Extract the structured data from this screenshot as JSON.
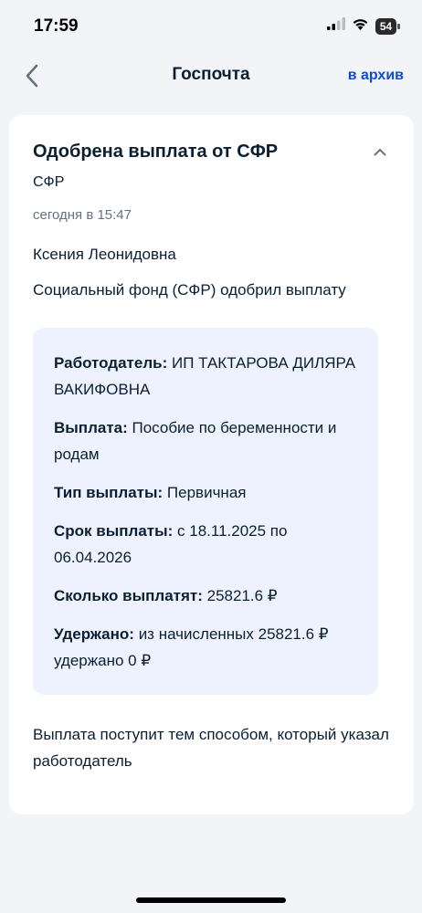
{
  "status_bar": {
    "time": "17:59",
    "battery": "54"
  },
  "nav": {
    "title": "Госпочта",
    "archive_label": "в архив"
  },
  "message": {
    "title": "Одобрена выплата от СФР",
    "sender": "СФР",
    "date": "сегодня в 15:47",
    "recipient": "Ксения Леонидовна",
    "lead": "Социальный фонд (СФР) одобрил выплату",
    "details": [
      {
        "label": "Работодатель:",
        "value": "ИП ТАКТАРОВА ДИЛЯРА ВАКИФОВНА"
      },
      {
        "label": "Выплата:",
        "value": "Пособие по беременности и родам"
      },
      {
        "label": "Тип выплаты:",
        "value": "Первичная"
      },
      {
        "label": "Срок выплаты:",
        "value": "с 18.11.2025 по 06.04.2026"
      },
      {
        "label": "Сколько выплатят:",
        "value": "25821.6 ₽"
      },
      {
        "label": "Удержано:",
        "value": "из начисленных 25821.6 ₽ удержано 0 ₽"
      }
    ],
    "footer": "Выплата поступит тем способом, который указал работодатель"
  }
}
